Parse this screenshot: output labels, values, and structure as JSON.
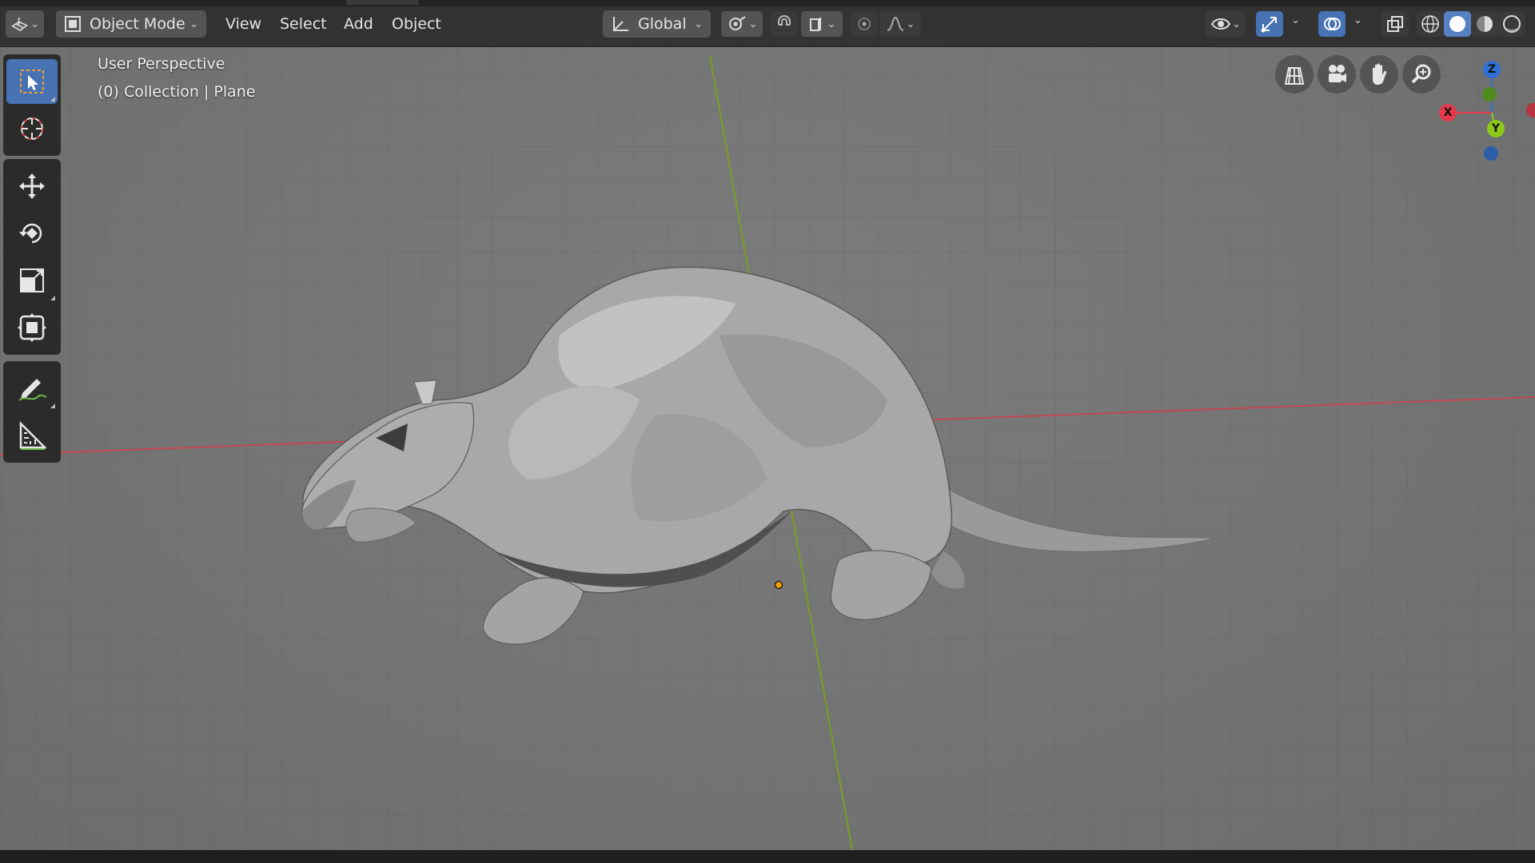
{
  "header": {
    "editor_type_icon": "grid-3d-icon",
    "mode_label": "Object Mode",
    "menus": [
      "View",
      "Select",
      "Add",
      "Object"
    ],
    "transform_orientation": "Global",
    "pivot_icon": "pivot-icon",
    "snap_icon": "magnet-icon",
    "proportional_icon": "proportional-edit-icon",
    "visibility_icon": "eye-icon",
    "gizmo_icon": "gizmo-icon",
    "overlay_icon": "overlay-icon",
    "xray_icon": "xray-icon",
    "shading_modes": [
      "wireframe",
      "solid",
      "material-preview",
      "rendered"
    ],
    "active_shading": "solid"
  },
  "viewport": {
    "view_name": "User Perspective",
    "collection_info": "(0) Collection | Plane",
    "model": "rat mesh",
    "colors": {
      "background": "#777777",
      "x_axis": "#c8414b",
      "y_axis": "#7aa520",
      "origin": "#f5a000",
      "active_tool": "#4772b3"
    }
  },
  "toolbar": {
    "tools": [
      {
        "name": "select-box",
        "active": true
      },
      {
        "name": "cursor",
        "active": false
      },
      {
        "name": "move",
        "active": false
      },
      {
        "name": "rotate",
        "active": false
      },
      {
        "name": "scale",
        "active": false
      },
      {
        "name": "transform",
        "active": false
      },
      {
        "name": "annotate",
        "active": false
      },
      {
        "name": "measure",
        "active": false
      }
    ]
  },
  "navigation": {
    "buttons": [
      "toggle-camera-icon",
      "camera-icon",
      "pan-hand-icon",
      "zoom-icon"
    ]
  },
  "gizmo": {
    "axes": [
      {
        "label": "Z",
        "color": "#2f6fd6"
      },
      {
        "label": "X",
        "color": "#e6384d"
      },
      {
        "label": "Y",
        "color": "#8cc919"
      }
    ]
  }
}
